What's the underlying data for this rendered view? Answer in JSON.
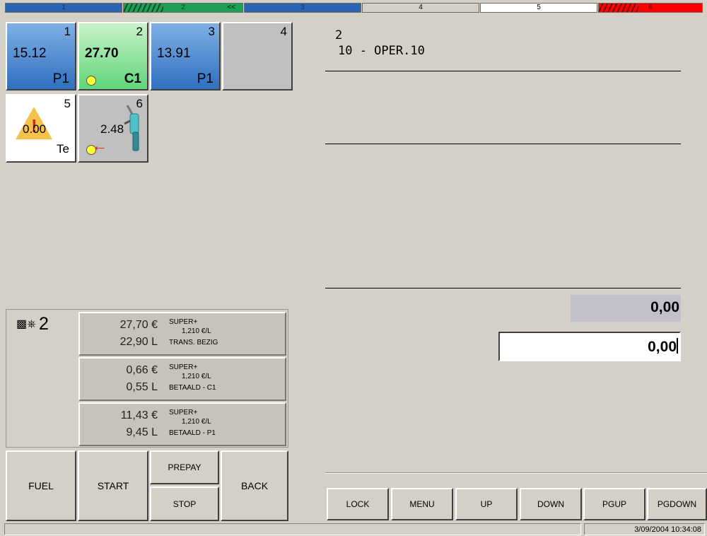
{
  "top_bar": {
    "segments": [
      "1",
      "2",
      "3",
      "4",
      "5",
      "6"
    ],
    "seg2_arrow": "<<",
    "colors": {
      "blue": "#2c64b4",
      "green": "#1da158",
      "red": "#ff0000",
      "white": "#ffffff",
      "grey": "#d4d0c8"
    }
  },
  "pumps": [
    {
      "num": "1",
      "amount": "15.12",
      "mode": "P1",
      "color": "blue"
    },
    {
      "num": "2",
      "amount": "27.70",
      "mode": "C1",
      "color": "green",
      "indicator": "yellow-dot"
    },
    {
      "num": "3",
      "amount": "13.91",
      "mode": "P1",
      "color": "blue"
    },
    {
      "num": "4",
      "color": "grey"
    },
    {
      "num": "5",
      "amount": "0.00",
      "mode": "Te",
      "color": "white",
      "icon": "warning-icon"
    },
    {
      "num": "6",
      "amount": "2.48",
      "color": "grey",
      "icon": "fuel-nozzle-icon",
      "indicator": "yellow-dot"
    }
  ],
  "transactions": {
    "pump": "2",
    "items": [
      {
        "amount": "27,70 €",
        "liters": "22,90 L",
        "fuel": "SUPER+",
        "price": "1,210 €/L",
        "status": "TRANS. BEZIG"
      },
      {
        "amount": "0,66 €",
        "liters": "0,55 L",
        "fuel": "SUPER+",
        "price": "1,210 €/L",
        "status": "BETAALD - C1"
      },
      {
        "amount": "11,43 €",
        "liters": "9,45 L",
        "fuel": "SUPER+",
        "price": "1,210 €/L",
        "status": "BETAALD - P1"
      }
    ]
  },
  "actions": {
    "fuel": "FUEL",
    "start": "START",
    "prepay": "PREPAY",
    "stop": "STOP",
    "back": "BACK"
  },
  "operator": {
    "number": "2",
    "name": "10 - OPER.10"
  },
  "totals": {
    "display": "0,00",
    "input": "0,00"
  },
  "function_keys": [
    "LOCK",
    "MENU",
    "UP",
    "DOWN",
    "PGUP",
    "PGDOWN"
  ],
  "status_bar": {
    "datetime": "3/09/2004 10:34:08"
  }
}
